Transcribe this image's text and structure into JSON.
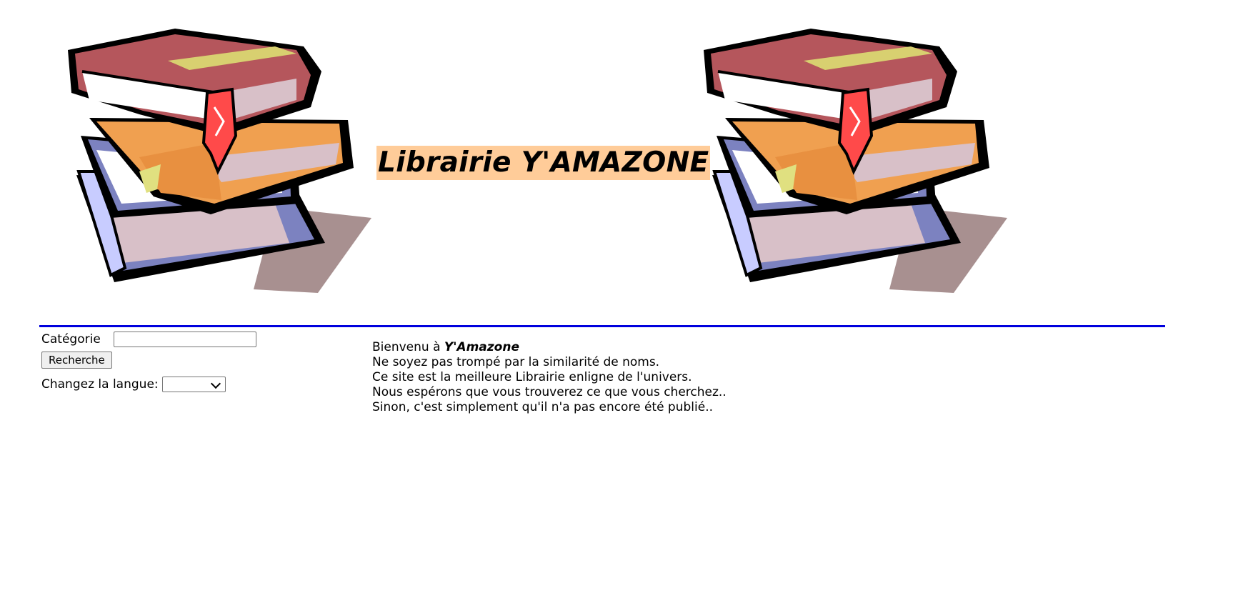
{
  "header": {
    "title": "Librairie Y'AMAZONE"
  },
  "sidebar": {
    "category_label": "Catégorie",
    "category_value": "",
    "search_button": "Recherche",
    "language_label": "Changez la langue:",
    "language_selected": ""
  },
  "welcome": {
    "intro": "Bienvenu à ",
    "brand": "Y'Amazone",
    "line2": "Ne soyez pas trompé par la similarité de noms.",
    "line3": "Ce site est la meilleure Librairie enligne de l'univers.",
    "line4": "Nous espérons que vous trouverez ce que vous cherchez..",
    "line5": "Sinon, c'est simplement qu'il n'a pas encore été publié.."
  },
  "colors": {
    "title_highlight": "#ffcc99",
    "divider": "#0000dd",
    "book_red": "#b5565c",
    "book_orange": "#f0a050",
    "book_blue": "#8088c0",
    "bookmark": "#ff4a4a"
  },
  "icons": {
    "book_stack": "book-stack-clipart"
  }
}
